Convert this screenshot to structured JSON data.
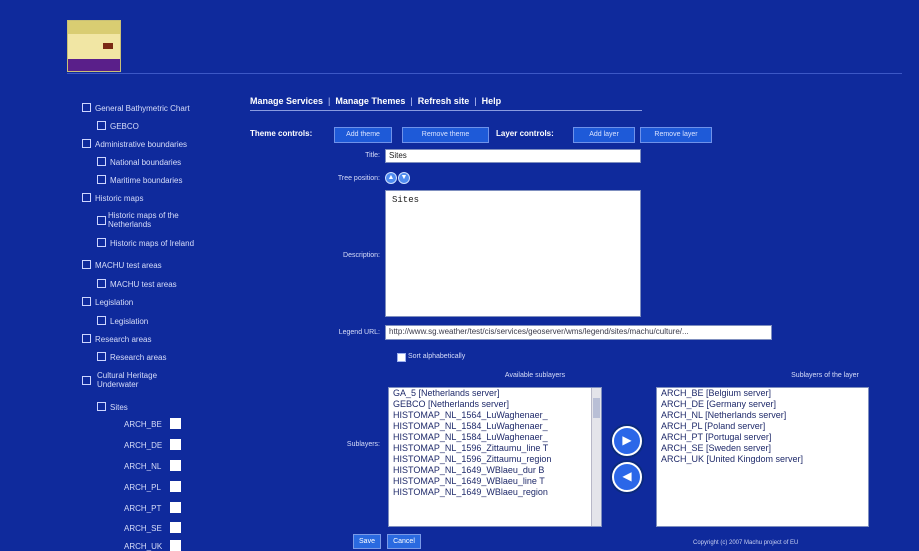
{
  "header": {
    "logo_icon": "folder-logo-icon"
  },
  "tree": [
    {
      "label": "General Bathymetric Chart"
    },
    {
      "label": "GEBCO"
    },
    {
      "label": "Administrative boundaries"
    },
    {
      "label": "National boundaries"
    },
    {
      "label": "Maritime boundaries"
    },
    {
      "label": "Historic maps"
    },
    {
      "label_l1": "Historic maps of the",
      "label_l2": "Netherlands"
    },
    {
      "label": "Historic maps of Ireland"
    },
    {
      "label": "MACHU test areas"
    },
    {
      "label": "MACHU test areas"
    },
    {
      "label": "Legislation"
    },
    {
      "label": "Legislation"
    },
    {
      "label": "Research areas"
    },
    {
      "label": "Research areas"
    },
    {
      "label_l1": "Cultural Heritage",
      "label_l2": "Underwater"
    },
    {
      "label": "Sites"
    }
  ],
  "tree_sites": [
    {
      "code": "ARCH_BE"
    },
    {
      "code": "ARCH_DE"
    },
    {
      "code": "ARCH_NL"
    },
    {
      "code": "ARCH_PL"
    },
    {
      "code": "ARCH_PT"
    },
    {
      "code": "ARCH_SE"
    },
    {
      "code": "ARCH_UK"
    }
  ],
  "nav": {
    "manage_services": "Manage Services",
    "manage_themes": "Manage Themes",
    "refresh_site": "Refresh site",
    "help": "Help",
    "separator": "|"
  },
  "controls": {
    "theme_label": "Theme controls:",
    "add_theme": "Add theme",
    "remove_theme": "Remove theme",
    "layer_label": "Layer controls:",
    "add_layer": "Add layer",
    "remove_layer": "Remove layer"
  },
  "form": {
    "title_label": "Title:",
    "title_value": "Sites",
    "tree_position_label": "Tree position:",
    "description_label": "Description:",
    "description_value": "Sites",
    "legend_url_label": "Legend URL:",
    "legend_url_value": "http://www.sg.weather/test/cis/services/geoserver/wms/legend/sites/machu/culture/...",
    "sort_label": "Sort alphabetically",
    "sublayers_label": "Sublayers:",
    "available_header": "Available sublayers",
    "selected_header": "Sublayers of the layer",
    "available": [
      "GA_5 [Netherlands server]",
      "GEBCO [Netherlands server]",
      "HISTOMAP_NL_1564_LuWaghenaer_",
      "HISTOMAP_NL_1584_LuWaghenaer_",
      "HISTOMAP_NL_1584_LuWaghenaer_",
      "HISTOMAP_NL_1596_Zittaumu_line T",
      "HISTOMAP_NL_1596_Zittaumu_region",
      "HISTOMAP_NL_1649_WBlaeu_dur B",
      "HISTOMAP_NL_1649_WBlaeu_line T",
      "HISTOMAP_NL_1649_WBlaeu_region"
    ],
    "selected": [
      "ARCH_BE [Belgium server]",
      "ARCH_DE [Germany server]",
      "ARCH_NL [Netherlands server]",
      "ARCH_PL [Poland server]",
      "ARCH_PT [Portugal server]",
      "ARCH_SE [Sweden server]",
      "ARCH_UK [United Kingdom server]"
    ],
    "save": "Save",
    "cancel": "Cancel"
  },
  "footer": {
    "copyright": "Copyright (c) 2007 Machu project of EU"
  },
  "colors": {
    "background": "#0f2a9c",
    "button": "#2a6ae0"
  }
}
